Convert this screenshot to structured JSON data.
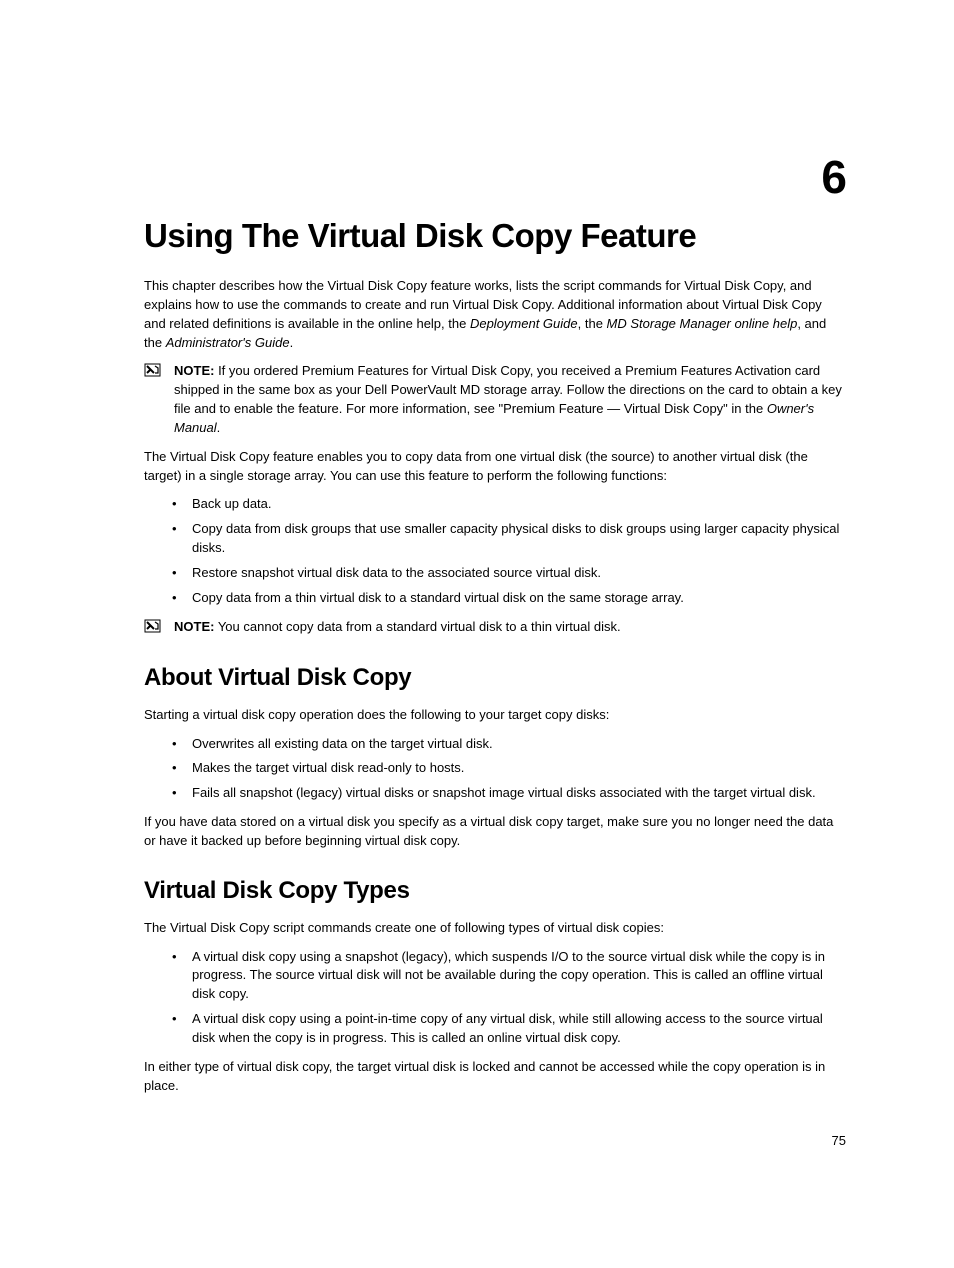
{
  "chapter_number": "6",
  "chapter_title": "Using The Virtual Disk Copy Feature",
  "intro_p1_a": "This chapter describes how the Virtual Disk Copy feature works, lists the script commands for Virtual Disk Copy, and explains how to use the commands to create and run Virtual Disk Copy. Additional information about Virtual Disk Copy and related definitions is available in the online help, the ",
  "intro_p1_i1": "Deployment Guide",
  "intro_p1_b": ", the ",
  "intro_p1_i2": "MD Storage Manager online help",
  "intro_p1_c": ", and the ",
  "intro_p1_i3": "Administrator's Guide",
  "intro_p1_d": ".",
  "note1_label": "NOTE:",
  "note1_a": " If you ordered Premium Features for Virtual Disk Copy, you received a Premium Features Activation card shipped in the same box as your Dell PowerVault MD storage array. Follow the directions on the card to obtain a key file and to enable the feature. For more information, see \"Premium Feature — Virtual Disk Copy\" in the ",
  "note1_i": "Owner's Manual",
  "note1_b": ".",
  "para2": "The Virtual Disk Copy feature enables you to copy data from one virtual disk (the source) to another virtual disk (the target) in a single storage array. You can use this feature to perform the following functions:",
  "list1": [
    "Back up data.",
    "Copy data from disk groups that use smaller capacity physical disks to disk groups using larger capacity physical disks.",
    "Restore snapshot virtual disk data to the associated source virtual disk.",
    "Copy data from a thin virtual disk to a standard virtual disk on the same storage array."
  ],
  "note2_label": "NOTE:",
  "note2_text": " You cannot copy data from a standard virtual disk to a thin virtual disk.",
  "h2_1": "About Virtual Disk Copy",
  "para3": "Starting a virtual disk copy operation does the following to your target copy disks:",
  "list2": [
    "Overwrites all existing data on the target virtual disk.",
    "Makes the target virtual disk read-only to hosts.",
    "Fails all snapshot (legacy) virtual disks or snapshot image virtual disks associated with the target virtual disk."
  ],
  "para4": "If you have data stored on a virtual disk you specify as a virtual disk copy target, make sure you no longer need the data or have it backed up before beginning virtual disk copy.",
  "h2_2": "Virtual Disk Copy Types",
  "para5": "The Virtual Disk Copy script commands create one of following types of virtual disk copies:",
  "list3": [
    "A virtual disk copy using a snapshot (legacy), which suspends I/O to the source virtual disk while the copy is in progress. The source virtual disk will not be available during the copy operation. This is called an offline virtual disk copy.",
    "A virtual disk copy using a point-in-time copy of any virtual disk, while still allowing access to the source virtual disk when the copy is in progress. This is called an online virtual disk copy."
  ],
  "para6": "In either type of virtual disk copy, the target virtual disk is locked and cannot be accessed while the copy operation is in place.",
  "page_number": "75"
}
